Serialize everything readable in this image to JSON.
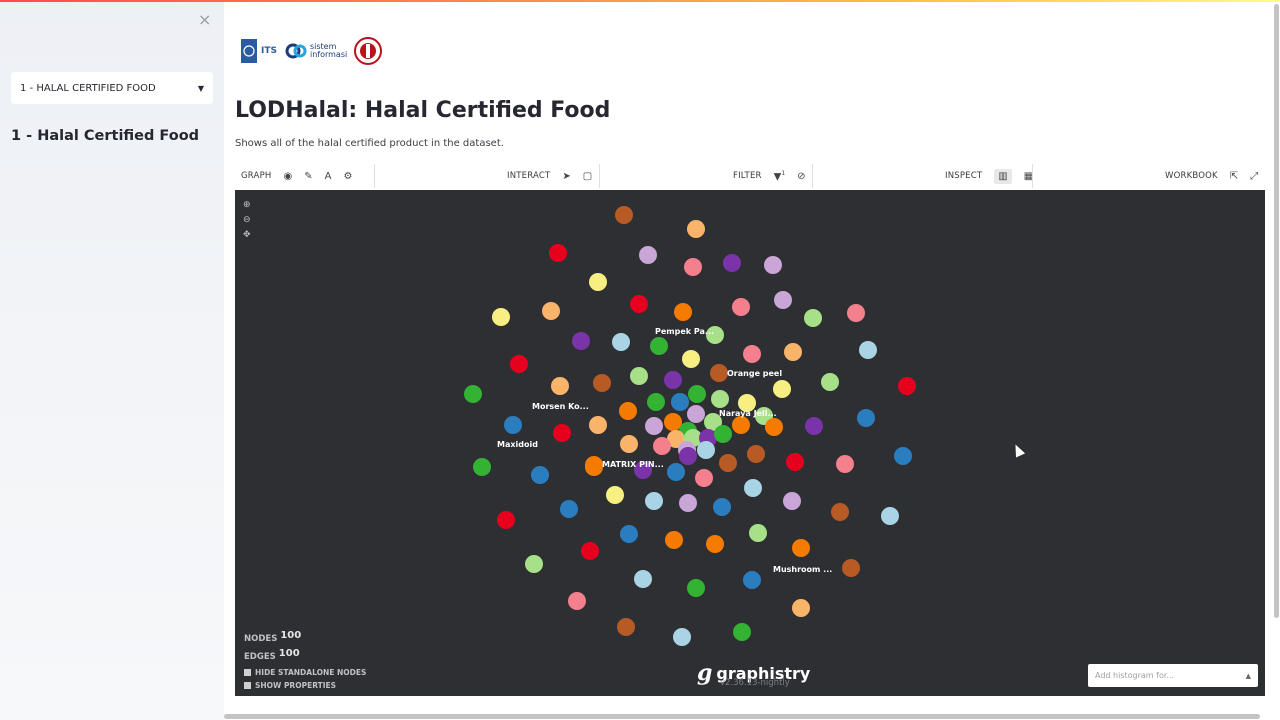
{
  "sidebar": {
    "close_glyph": "×",
    "select_value": "1 - HALAL CERTIFIED FOOD",
    "heading": "1 - Halal Certified Food"
  },
  "logos": {
    "its": "ITS",
    "si": "sistem informasi"
  },
  "page": {
    "title": "LODHalal: Halal Certified Food",
    "description": "Shows all of the halal certified product in the dataset."
  },
  "toolbar": {
    "graph_label": "GRAPH",
    "interact_label": "INTERACT",
    "filter_label": "FILTER",
    "filter_badge": "1",
    "inspect_label": "INSPECT",
    "workbook_label": "WORKBOOK"
  },
  "graph": {
    "node_labels": [
      {
        "text": "Pempek Pa..."
      },
      {
        "text": "Orange peel"
      },
      {
        "text": "Morsen Ko..."
      },
      {
        "text": "Naraya Jell..."
      },
      {
        "text": "Maxidoid"
      },
      {
        "text": "MATRIX PIN..."
      },
      {
        "text": "Mushroom ..."
      }
    ],
    "palette": [
      "#e6001e",
      "#f7ef81",
      "#f9b46a",
      "#33b233",
      "#7a33a8",
      "#a8d4e6",
      "#2a7ec0",
      "#a8e08a",
      "#f3808c",
      "#f57b00",
      "#b85a24",
      "#c9a5d8"
    ],
    "stats": {
      "nodes_label": "NODES",
      "nodes_value": "100",
      "edges_label": "EDGES",
      "edges_value": "100"
    },
    "options": {
      "hide_standalone": "HIDE STANDALONE NODES",
      "show_properties": "SHOW PROPERTIES"
    },
    "brand": "graphistry",
    "version": "v2.36.13-nightly",
    "histogram_placeholder": "Add histogram for..."
  }
}
